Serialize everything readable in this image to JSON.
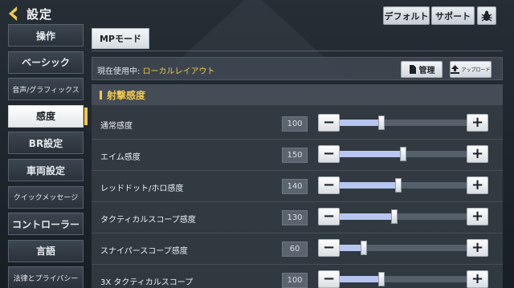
{
  "header": {
    "title": "設定"
  },
  "top_buttons": {
    "default": "デフォルト",
    "support": "サポート"
  },
  "sidebar": {
    "items": [
      {
        "label": "操作",
        "small": false,
        "active": false
      },
      {
        "label": "ベーシック",
        "small": false,
        "active": false
      },
      {
        "label": "音声/グラフィックス",
        "small": true,
        "active": false
      },
      {
        "label": "感度",
        "small": false,
        "active": true
      },
      {
        "label": "BR設定",
        "small": false,
        "active": false
      },
      {
        "label": "車両設定",
        "small": false,
        "active": false
      },
      {
        "label": "クイックメッセージ",
        "small": true,
        "active": false
      },
      {
        "label": "コントローラー",
        "small": false,
        "active": false
      },
      {
        "label": "言語",
        "small": false,
        "active": false
      },
      {
        "label": "法律とプライバシー",
        "small": true,
        "active": false
      }
    ]
  },
  "mode_tab": {
    "label": "MPモード"
  },
  "layout": {
    "prefix": "現在使用中: ",
    "name": "ローカルレイアウト",
    "manage_label": "管理",
    "upload_label": "アップロード"
  },
  "section": {
    "title": "射撃感度"
  },
  "settings": [
    {
      "label": "通常感度",
      "value": "100",
      "level": 0.33
    },
    {
      "label": "エイム感度",
      "value": "150",
      "level": 0.5
    },
    {
      "label": "レッドドット/ホロ感度",
      "value": "140",
      "level": 0.46
    },
    {
      "label": "タクティカルスコープ感度",
      "value": "130",
      "level": 0.43
    },
    {
      "label": "スナイパースコープ感度",
      "value": "60",
      "level": 0.19
    },
    {
      "label": "3X タクティカルスコープ",
      "value": "100",
      "level": 0.33
    }
  ],
  "colors": {
    "accent": "#f2c94c",
    "slider_fill": "#b7c6f0"
  }
}
